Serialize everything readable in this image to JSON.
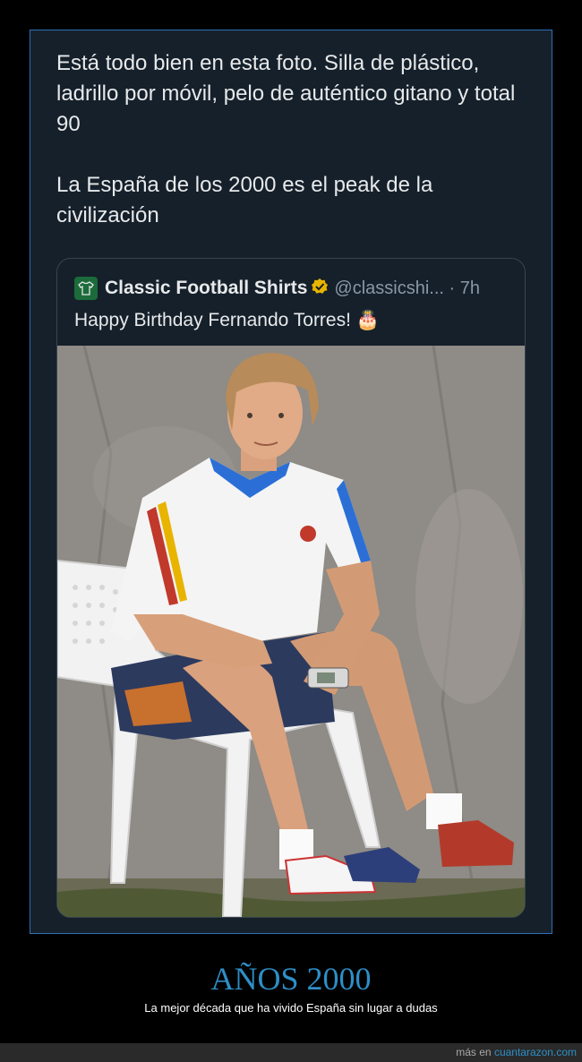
{
  "tweet": {
    "paragraphs": [
      "Está todo bien en esta foto. Silla de plástico, ladrillo por móvil, pelo de auténtico gitano y total 90",
      "La España de los 2000 es el peak de la civilización"
    ]
  },
  "quote": {
    "name": "Classic Football Shirts",
    "handle": "@classicshi... · 7h",
    "text": "Happy Birthday Fernando Torres! 🎂",
    "verified_color": "#e8b400"
  },
  "caption": {
    "title": "AÑOS 2000",
    "subtitle": "La mejor década que ha vivido España sin lugar a dudas"
  },
  "footer": {
    "prefix": "más en",
    "link": "cuantarazon.com"
  },
  "colors": {
    "background": "#000000",
    "card": "#15202b",
    "accent": "#2d8fc7"
  }
}
